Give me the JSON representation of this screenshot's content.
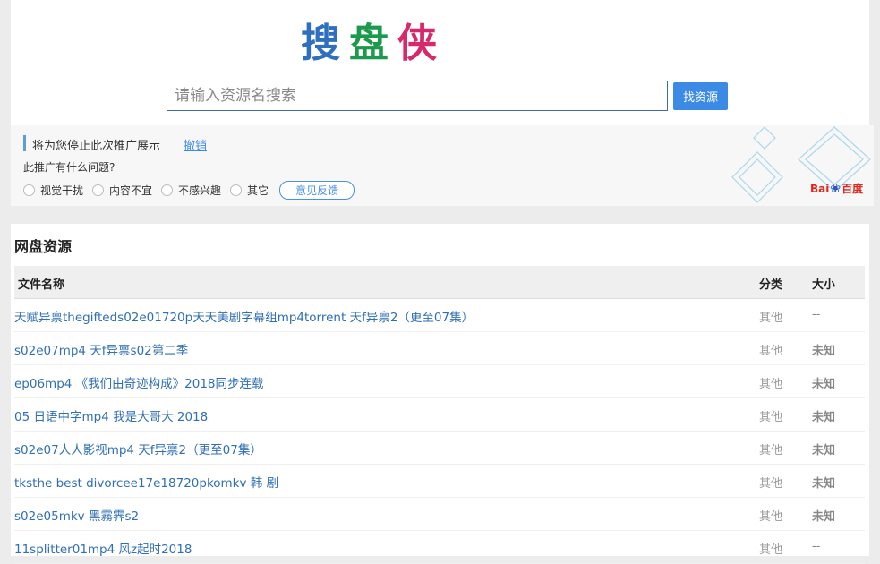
{
  "logo": {
    "chars": [
      "搜",
      "盘",
      "侠"
    ],
    "colors": [
      "#2f6fc0",
      "#1a9a4a",
      "#d6286a"
    ]
  },
  "search": {
    "placeholder": "请输入资源名搜索",
    "button_label": "找资源"
  },
  "ad": {
    "title": "将为您停止此次推广展示",
    "undo_label": "撤销",
    "question": "此推广有什么问题?",
    "options": [
      "视觉干扰",
      "内容不宜",
      "不感兴趣",
      "其它"
    ],
    "feedback_label": "意见反馈",
    "brand_text_left": "Bai",
    "brand_text_right": "百度"
  },
  "results": {
    "section_title": "网盘资源",
    "headers": {
      "name": "文件名称",
      "category": "分类",
      "size": "大小"
    },
    "rows": [
      {
        "name": "天赋异禀thegifteds02e01720p天天美剧字幕组mp4torrent 天f异禀2（更至07集）",
        "category": "其他",
        "size": "--"
      },
      {
        "name": "s02e07mp4 天f异禀s02第二季",
        "category": "其他",
        "size": "未知"
      },
      {
        "name": "ep06mp4 《我们由奇迹构成》2018同步连载",
        "category": "其他",
        "size": "未知"
      },
      {
        "name": "05 日语中字mp4 我是大哥大 2018",
        "category": "其他",
        "size": "未知"
      },
      {
        "name": "s02e07人人影视mp4 天f异禀2（更至07集）",
        "category": "其他",
        "size": "未知"
      },
      {
        "name": "tksthe best divorcee17e18720pkomkv 韩 剧",
        "category": "其他",
        "size": "未知"
      },
      {
        "name": "s02e05mkv 黑霧霁s2",
        "category": "其他",
        "size": "未知"
      },
      {
        "name": "11splitter01mp4 风z起时2018",
        "category": "其他",
        "size": "--"
      }
    ]
  },
  "colors": {
    "accent": "#3b8be6",
    "link": "#2f6fb5"
  }
}
